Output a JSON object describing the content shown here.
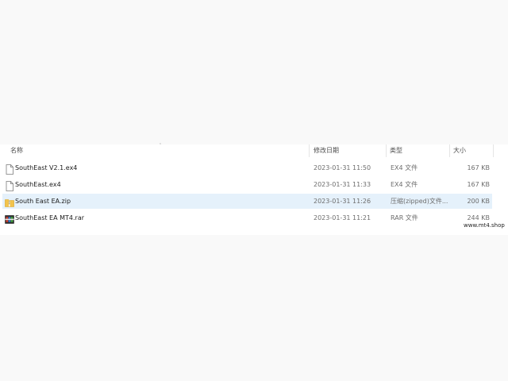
{
  "columns": {
    "name": "名称",
    "date": "修改日期",
    "type": "类型",
    "size": "大小"
  },
  "files": [
    {
      "name": "SouthEast V2.1.ex4",
      "date": "2023-01-31 11:50",
      "type": "EX4 文件",
      "size": "167 KB",
      "icon": "document-icon",
      "selected": false
    },
    {
      "name": "SouthEast.ex4",
      "date": "2023-01-31 11:33",
      "type": "EX4 文件",
      "size": "167 KB",
      "icon": "document-icon",
      "selected": false
    },
    {
      "name": "South East EA.zip",
      "date": "2023-01-31 11:26",
      "type": "压缩(zipped)文件...",
      "size": "200 KB",
      "icon": "zip-folder-icon",
      "selected": true
    },
    {
      "name": "SouthEast EA MT4.rar",
      "date": "2023-01-31 11:21",
      "type": "RAR 文件",
      "size": "244 KB",
      "icon": "rar-archive-icon",
      "selected": false
    }
  ],
  "watermark": "www.mt4.shop",
  "colors": {
    "selection": "#e5f1fb",
    "zip_folder": "#f2c34c",
    "rar_icon": "#2b2b2b"
  }
}
